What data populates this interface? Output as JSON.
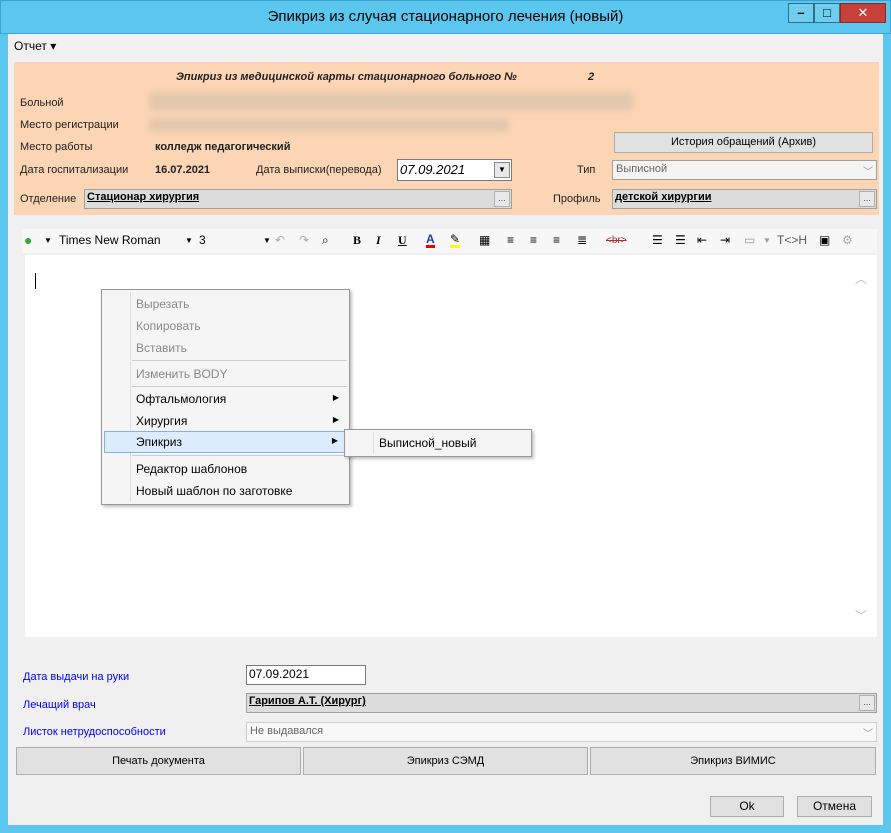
{
  "window": {
    "title": "Эпикриз из случая стационарного лечения (новый)"
  },
  "menu": {
    "report": "Отчет ▾"
  },
  "header": {
    "heading": "Эпикриз из медицинской карты стационарного больного №",
    "card_number": "2",
    "patient_label": "Больной",
    "registration_label": "Место регистрации",
    "work_label": "Место работы",
    "work_value": "колледж педагогический",
    "history_button": "История обращений (Архив)",
    "admission_label": "Дата госпитализации",
    "admission_value": "16.07.2021",
    "discharge_label": "Дата выписки(перевода)",
    "discharge_value": "07.09.2021",
    "type_label": "Тип",
    "type_value": "Выписной",
    "department_label": "Отделение",
    "department_value": "Стационар хирургия",
    "profile_label": "Профиль",
    "profile_value": "детской хирургии"
  },
  "toolbar": {
    "font": "Times New Roman",
    "size": "3",
    "bold": "B",
    "italic": "I",
    "underline": "U",
    "br": "<br>",
    "tag": "T<>H"
  },
  "context_menu": {
    "items": [
      {
        "label": "Вырезать",
        "disabled": true
      },
      {
        "label": "Копировать",
        "disabled": true
      },
      {
        "label": "Вставить",
        "disabled": true
      },
      {
        "label": "Изменить BODY",
        "disabled": true
      },
      {
        "label": "Офтальмология",
        "submenu": true
      },
      {
        "label": "Хирургия",
        "submenu": true
      },
      {
        "label": "Эпикриз",
        "submenu": true
      },
      {
        "label": "Редактор шаблонов"
      },
      {
        "label": "Новый шаблон по заготовке"
      }
    ],
    "submenu_item": "Выписной_новый"
  },
  "footer": {
    "issue_date_label": "Дата выдачи на руки",
    "issue_date_value": "07.09.2021",
    "doctor_label": "Лечащий врач",
    "doctor_value": "Гарипов А.Т. (Хирург)",
    "sick_leave_label": "Листок нетрудоспособности",
    "sick_leave_value": "Не выдавался",
    "print_button": "Печать документа",
    "semd_button": "Эпикриз СЭМД",
    "vimis_button": "Эпикриз ВИМИС",
    "ok_button": "Ok",
    "cancel_button": "Отмена"
  },
  "colors": {
    "titlebar": "#5bc7ee",
    "header_bg": "#fcd5b4",
    "label_blue": "#0000ff"
  }
}
